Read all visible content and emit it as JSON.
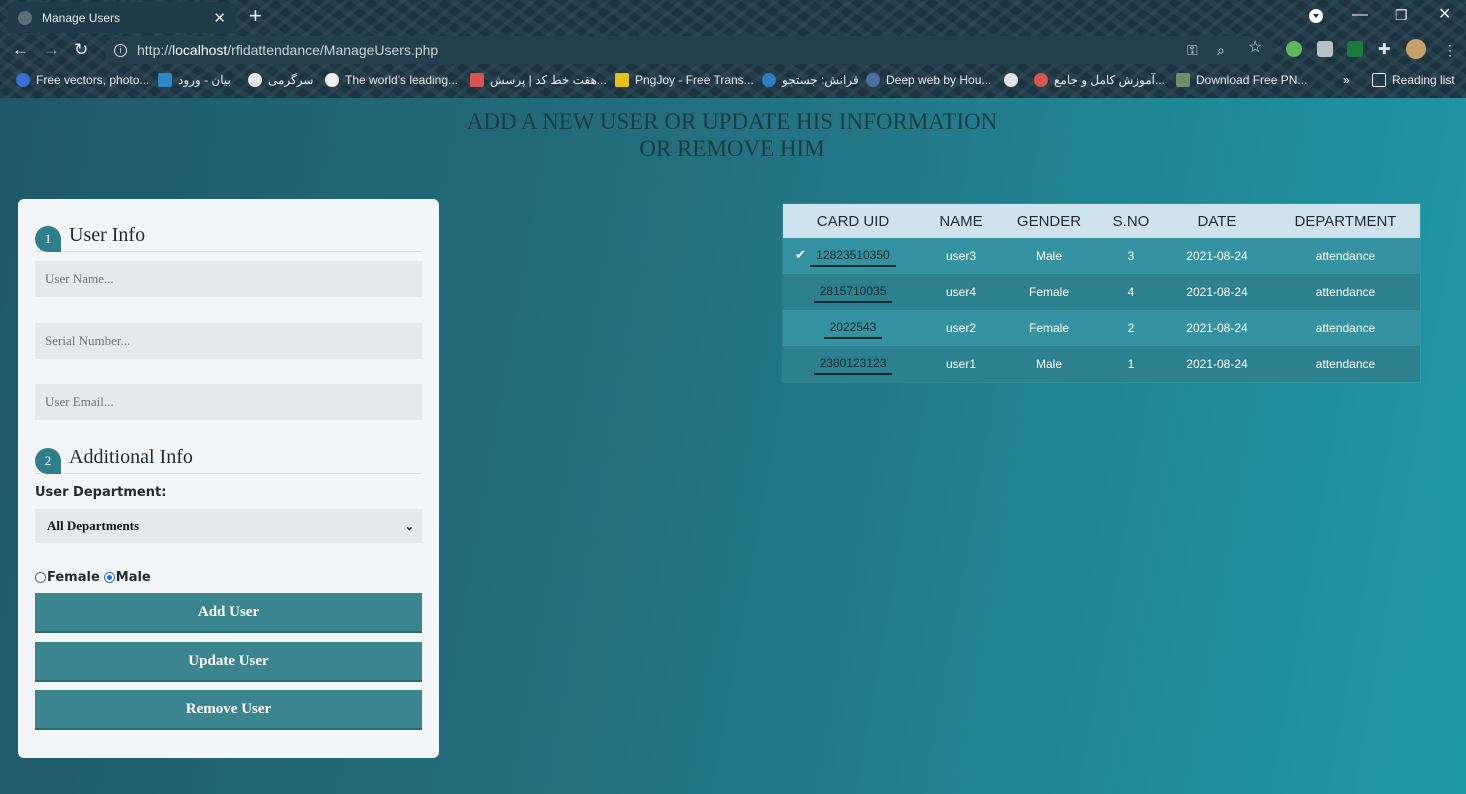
{
  "browser": {
    "tab_title": "Manage Users",
    "url_prefix": "http://",
    "url_host": "localhost",
    "url_path": "/rfidattendance/ManageUsers.php",
    "bookmarks": [
      "Free vectors, photo...",
      "بیان - ورود",
      "سرگرمی",
      "The world's leading...",
      "هفت خط کد | پرسش...",
      "PngJoy - Free Trans...",
      "قرانش: جستجو",
      "Deep web by Hou...",
      "آموزش کامل و جامع...",
      "Download Free PN...",
      "Reading list"
    ],
    "more_bookmarks": "»"
  },
  "page": {
    "heading_line1": "ADD A NEW USER OR UPDATE HIS INFORMATION",
    "heading_line2": "OR REMOVE HIM"
  },
  "form": {
    "section1_number": "1",
    "section1_title": "User Info",
    "user_name_placeholder": "User Name...",
    "serial_placeholder": "Serial Number...",
    "email_placeholder": "User Email...",
    "section2_number": "2",
    "section2_title": "Additional Info",
    "department_label": "User Department:",
    "department_selected": "All Departments",
    "gender_female": "Female",
    "gender_male": "Male",
    "gender_selected": "Male",
    "add_button": "Add User",
    "update_button": "Update User",
    "remove_button": "Remove User"
  },
  "table": {
    "columns": [
      "CARD UID",
      "NAME",
      "GENDER",
      "S.NO",
      "DATE",
      "DEPARTMENT"
    ],
    "rows": [
      {
        "uid": "12823510350",
        "name": "user3",
        "gender": "Male",
        "sno": "3",
        "date": "2021-08-24",
        "department": "attendance",
        "selected": true
      },
      {
        "uid": "2815710035",
        "name": "user4",
        "gender": "Female",
        "sno": "4",
        "date": "2021-08-24",
        "department": "attendance",
        "selected": false
      },
      {
        "uid": "2022543",
        "name": "user2",
        "gender": "Female",
        "sno": "2",
        "date": "2021-08-24",
        "department": "attendance",
        "selected": false
      },
      {
        "uid": "2380123123",
        "name": "user1",
        "gender": "Male",
        "sno": "1",
        "date": "2021-08-24",
        "department": "attendance",
        "selected": false
      }
    ]
  }
}
